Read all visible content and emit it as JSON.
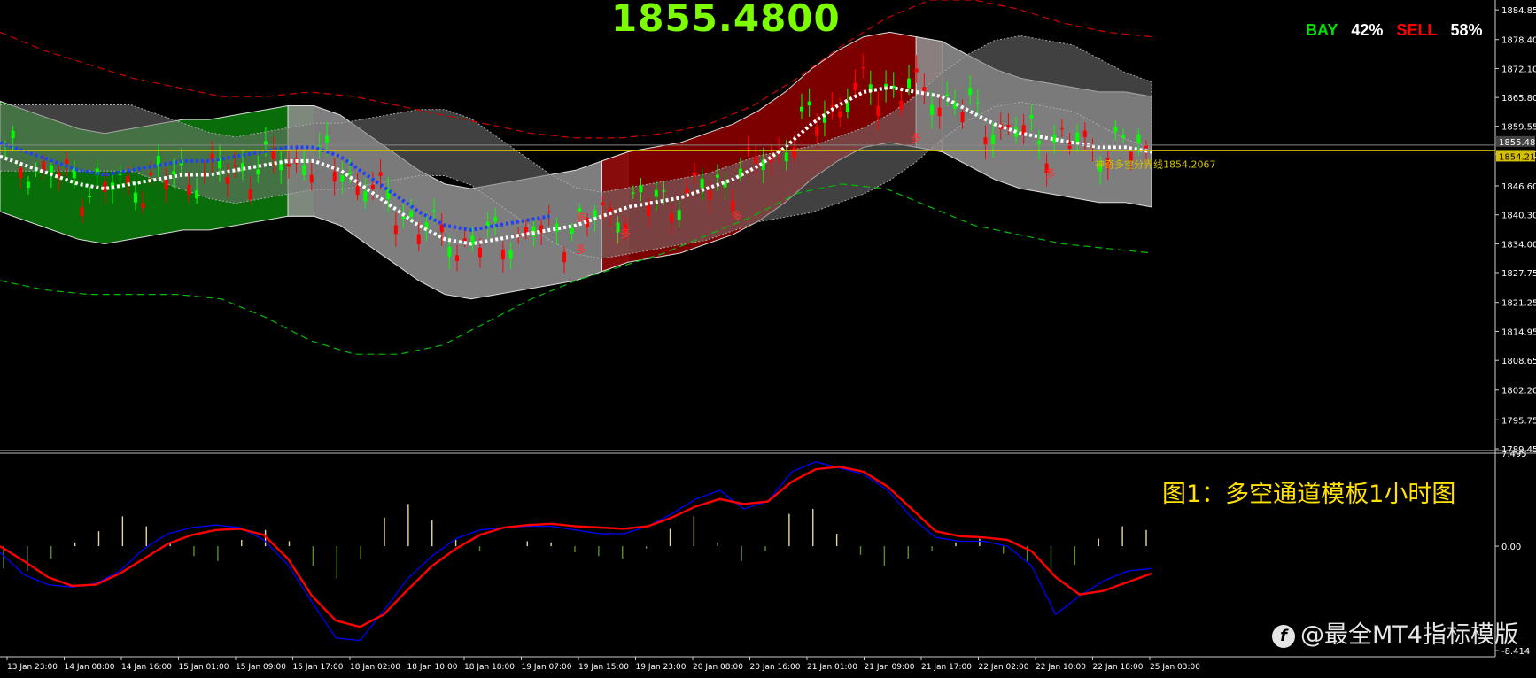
{
  "header": {
    "price": "1855.4800",
    "bay_label": "BAY",
    "bay_pct": "42%",
    "sell_label": "SELL",
    "sell_pct": "58%"
  },
  "colors": {
    "background": "#000000",
    "price_big": "#7CFC00",
    "bay": "#00E000",
    "sell": "#FF0000",
    "bull_candle": "#00FF00",
    "bear_candle": "#FF0000",
    "green_channel": "#0A7A0A",
    "red_channel": "#8B0000",
    "grey_channel": "#8C8C8C",
    "fast_line": "#FF0000",
    "signal_line": "#0000FF",
    "horizontal_line": "#D4C000"
  },
  "annotations": {
    "divider_label": "神奇多空分界线1854.2067",
    "caption": "图1：多空通道模板1小时图",
    "watermark": "@最全MT4指标模版",
    "arrow_char": "多"
  },
  "chart_data": [
    {
      "type": "line",
      "panel": "price",
      "ylim": [
        1789.45,
        1887.0
      ],
      "y_tick_labels": [
        "1884.85",
        "1878.40",
        "1872.10",
        "1865.80",
        "1859.55",
        "1853.50",
        "1846.60",
        "1840.30",
        "1834.00",
        "1827.75",
        "1821.25",
        "1814.95",
        "1808.65",
        "1802.20",
        "1795.75",
        "1789.45"
      ],
      "price_tags": [
        "1855.48",
        "1854.21"
      ],
      "x_tick_labels": [
        "13 Jan 23:00",
        "14 Jan 08:00",
        "14 Jan 16:00",
        "15 Jan 01:00",
        "15 Jan 09:00",
        "15 Jan 17:00",
        "18 Jan 02:00",
        "18 Jan 10:00",
        "18 Jan 18:00",
        "19 Jan 07:00",
        "19 Jan 15:00",
        "19 Jan 23:00",
        "20 Jan 08:00",
        "20 Jan 16:00",
        "21 Jan 01:00",
        "21 Jan 09:00",
        "21 Jan 17:00",
        "22 Jan 02:00",
        "22 Jan 10:00",
        "22 Jan 18:00",
        "25 Jan 03:00"
      ],
      "mid_line": [
        1853,
        1851,
        1849,
        1847,
        1846,
        1847,
        1848,
        1849,
        1849,
        1850,
        1851,
        1852,
        1852,
        1850,
        1846,
        1842,
        1838,
        1835,
        1834,
        1835,
        1836,
        1837,
        1838,
        1840,
        1842,
        1843,
        1844,
        1846,
        1848,
        1851,
        1855,
        1860,
        1864,
        1867,
        1868,
        1867,
        1866,
        1863,
        1860,
        1858,
        1857,
        1856,
        1855,
        1855,
        1854
      ],
      "channel_half_width": 12,
      "outer_upper": [
        1880,
        1876,
        1873,
        1870,
        1868,
        1866,
        1866,
        1867,
        1866,
        1864,
        1862,
        1860,
        1858,
        1857,
        1857,
        1858,
        1860,
        1864,
        1870,
        1877,
        1883,
        1887,
        1887,
        1885,
        1882,
        1880,
        1879
      ],
      "outer_lower": [
        1826,
        1824,
        1823,
        1823,
        1823,
        1822,
        1818,
        1813,
        1810,
        1810,
        1812,
        1817,
        1822,
        1826,
        1829,
        1832,
        1836,
        1840,
        1845,
        1847,
        1846,
        1842,
        1838,
        1836,
        1834,
        1833,
        1832
      ],
      "channel_regimes": [
        "green",
        "grey",
        "red",
        "grey"
      ],
      "divider_value": 1854.21,
      "last_price": 1855.48
    },
    {
      "type": "line",
      "panel": "oscillator",
      "ylim": [
        -8.414,
        7.495
      ],
      "y_tick_labels": [
        "7.495",
        "0.00",
        "-8.414"
      ],
      "series": [
        {
          "values": [
            0.0,
            -1.2,
            -2.5,
            -3.2,
            -3.1,
            -2.2,
            -1.0,
            0.2,
            0.9,
            1.3,
            1.4,
            0.9,
            -1.0,
            -4.0,
            -6.0,
            -6.5,
            -5.5,
            -3.5,
            -1.6,
            -0.2,
            0.9,
            1.5,
            1.7,
            1.8,
            1.6,
            1.5,
            1.4,
            1.6,
            2.3,
            3.2,
            3.8,
            3.4,
            3.6,
            5.2,
            6.2,
            6.4,
            6.0,
            4.8,
            3.0,
            1.2,
            0.8,
            0.7,
            0.5,
            -0.4,
            -2.5,
            -3.9,
            -3.6,
            -2.9,
            -2.2
          ]
        },
        {
          "values": [
            -0.5,
            -2.3,
            -3.1,
            -3.3,
            -3.0,
            -2.0,
            -0.2,
            1.0,
            1.5,
            1.7,
            1.5,
            0.5,
            -1.5,
            -4.5,
            -7.4,
            -7.6,
            -5.2,
            -2.6,
            -0.8,
            0.6,
            1.3,
            1.5,
            1.6,
            1.6,
            1.3,
            1.0,
            1.0,
            1.6,
            2.6,
            3.8,
            4.5,
            3.0,
            3.6,
            6.0,
            6.8,
            6.3,
            5.8,
            4.5,
            2.3,
            0.7,
            0.4,
            0.4,
            0.0,
            -1.6,
            -5.5,
            -4.0,
            -2.8,
            -2.0,
            -1.8
          ]
        },
        {
          "type": "bar",
          "values": [
            -1.8,
            -2.0,
            -1.0,
            0.3,
            1.2,
            2.4,
            1.6,
            0.3,
            -0.8,
            -1.2,
            0.5,
            1.3,
            0.4,
            -1.6,
            -2.6,
            -1.0,
            2.3,
            3.4,
            2.1,
            0.5,
            -0.4,
            0.0,
            0.4,
            0.3,
            -0.5,
            -0.8,
            -1.0,
            -0.2,
            1.4,
            2.4,
            0.3,
            -1.2,
            -0.4,
            2.6,
            3.0,
            1.0,
            -0.7,
            -1.6,
            -1.0,
            -0.4,
            0.3,
            0.6,
            -0.6,
            -1.2,
            -2.1,
            -1.5,
            0.6,
            1.6,
            1.3
          ]
        }
      ]
    }
  ]
}
